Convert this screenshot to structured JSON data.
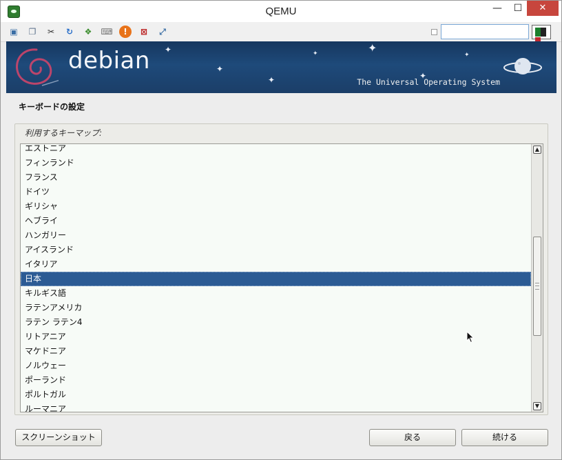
{
  "window": {
    "title": "QEMU",
    "controls": {
      "minimize": "—",
      "maximize": "☐",
      "close": "✕"
    }
  },
  "toolbar": {
    "icons": [
      {
        "name": "monitor-icon",
        "glyph": "▣",
        "color": "#3a6ea5"
      },
      {
        "name": "windows-icon",
        "glyph": "❐",
        "color": "#5a6f8a"
      },
      {
        "name": "tools-icon",
        "glyph": "✂",
        "color": "#333333"
      },
      {
        "name": "refresh-icon",
        "glyph": "↻",
        "color": "#2a6fc9"
      },
      {
        "name": "windows-logo-icon",
        "glyph": "❖",
        "color": "#3c8d2f"
      },
      {
        "name": "keyboard-icon",
        "glyph": "⌨",
        "color": "#777777"
      },
      {
        "name": "warning-icon",
        "glyph": "!",
        "color": "#e8731a"
      },
      {
        "name": "network-disconnect-icon",
        "glyph": "⊠",
        "color": "#bb2222"
      },
      {
        "name": "fullscreen-icon",
        "glyph": "⤢",
        "color": "#3a6ea5"
      }
    ],
    "input_value": "",
    "flag_colors": [
      "#1a7f2c",
      "#222222",
      "#c1272d"
    ]
  },
  "banner": {
    "logo": "debian",
    "tagline": "The Universal Operating System"
  },
  "installer": {
    "section_title": "キーボードの設定",
    "group_label": "利用するキーマップ:",
    "keymaps": [
      "エストニア",
      "フィンランド",
      "フランス",
      "ドイツ",
      "ギリシャ",
      "ヘブライ",
      "ハンガリー",
      "アイスランド",
      "イタリア",
      "日本",
      "キルギス語",
      "ラテンアメリカ",
      "ラテン ラテン4",
      "リトアニア",
      "マケドニア",
      "ノルウェー",
      "ポーランド",
      "ポルトガル",
      "ルーマニア"
    ],
    "selected_keymap": "日本",
    "scroll_up": "▲",
    "scroll_down": "▼"
  },
  "buttons": {
    "screenshot": "スクリーンショット",
    "back": "戻る",
    "continue": "続ける"
  }
}
